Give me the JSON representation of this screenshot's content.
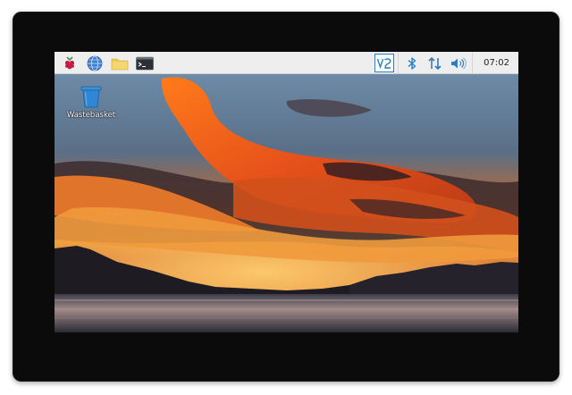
{
  "taskbar": {
    "launchers": [
      {
        "icon": "raspberry-menu-icon"
      },
      {
        "icon": "web-browser-icon"
      },
      {
        "icon": "file-manager-icon"
      },
      {
        "icon": "terminal-icon"
      }
    ],
    "tray": {
      "vnc_icon": "vnc-icon",
      "bluetooth_icon": "bluetooth-icon",
      "network_icon": "network-arrows-icon",
      "volume_icon": "volume-icon",
      "clock": "07:02"
    }
  },
  "desktop": {
    "icons": [
      {
        "label": "Wastebasket",
        "icon": "wastebasket-icon"
      }
    ]
  },
  "colors": {
    "accent_blue": "#2a7fc4",
    "taskbar_bg": "#eeeeee",
    "bezel": "#0b0b0c",
    "folder_yellow": "#f2c94c",
    "raspberry_red": "#c51a4a"
  }
}
